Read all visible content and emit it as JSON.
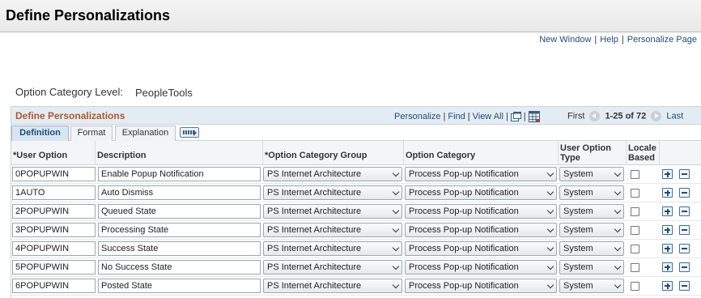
{
  "page": {
    "title": "Define Personalizations"
  },
  "top_links": {
    "new_window": "New Window",
    "help": "Help",
    "personalize_page": "Personalize Page"
  },
  "option_category_level": {
    "label": "Option Category Level:",
    "value": "PeopleTools"
  },
  "grid": {
    "title": "Define Personalizations",
    "tools": {
      "personalize": "Personalize",
      "find": "Find",
      "view_all": "View All"
    },
    "nav": {
      "first": "First",
      "range": "1-25 of 72",
      "last": "Last"
    },
    "tabs": [
      "Definition",
      "Format",
      "Explanation"
    ],
    "columns": {
      "user_option": "*User Option",
      "description": "Description",
      "option_category_group": "*Option Category Group",
      "option_category": "Option Category",
      "user_option_type": "User Option Type",
      "locale_based": "Locale Based"
    },
    "rows": [
      {
        "user_option": "0POPUPWIN",
        "description": "Enable Popup Notification",
        "group": "PS Internet Architecture",
        "category": "Process Pop-up Notification",
        "type": "System"
      },
      {
        "user_option": "1AUTO",
        "description": "Auto Dismiss",
        "group": "PS Internet Architecture",
        "category": "Process Pop-up Notification",
        "type": "System"
      },
      {
        "user_option": "2POPUPWIN",
        "description": "Queued State",
        "group": "PS Internet Architecture",
        "category": "Process Pop-up Notification",
        "type": "System"
      },
      {
        "user_option": "3POPUPWIN",
        "description": "Processing State",
        "group": "PS Internet Architecture",
        "category": "Process Pop-up Notification",
        "type": "System"
      },
      {
        "user_option": "4POPUPWIN",
        "description": "Success State",
        "group": "PS Internet Architecture",
        "category": "Process Pop-up Notification",
        "type": "System"
      },
      {
        "user_option": "5POPUPWIN",
        "description": "No Success State",
        "group": "PS Internet Architecture",
        "category": "Process Pop-up Notification",
        "type": "System"
      },
      {
        "user_option": "6POPUPWIN",
        "description": "Posted State",
        "group": "PS Internet Architecture",
        "category": "Process Pop-up Notification",
        "type": "System"
      }
    ]
  }
}
